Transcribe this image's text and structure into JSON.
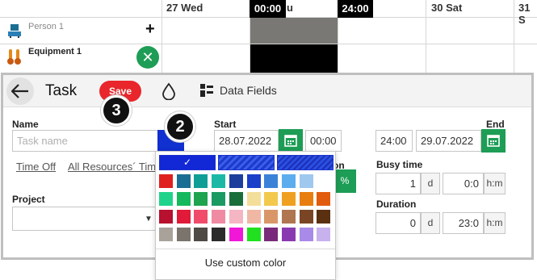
{
  "scheduler": {
    "day_labels": [
      "27 Wed",
      "u",
      "30 Sat",
      "31 S"
    ],
    "start_marker": "00:00",
    "end_marker": "24:00",
    "resources": [
      {
        "label": "Person 1",
        "icon": "person-icon"
      },
      {
        "label": "Equipment 1",
        "icon": "equipment-icon"
      }
    ],
    "add_symbol": "+",
    "remove_symbol": "✕"
  },
  "toolbar": {
    "title": "Task",
    "save_label": "Save",
    "data_fields_label": "Data Fields"
  },
  "form": {
    "name_label": "Name",
    "name_placeholder": "Task name",
    "links": [
      "Time Off",
      "All Resources´ Tim"
    ],
    "project_label": "Project",
    "project_value": "",
    "start_label": "Start",
    "start_date": "28.07.2022",
    "start_time": "00:00",
    "end_label": "End",
    "end_time": "24:00",
    "end_date": "29.07.2022",
    "partial_label": "on",
    "percent_symbol": "%",
    "busy_label": "Busy time",
    "busy_days": "1",
    "busy_days_unit": "d",
    "busy_hm": "0:0",
    "busy_hm_unit": "h:m",
    "duration_label": "Duration",
    "duration_days": "0",
    "duration_days_unit": "d",
    "duration_hm": "23:0",
    "duration_hm_unit": "h:m"
  },
  "color_picker": {
    "selected_check": "✓",
    "custom_label": "Use custom color",
    "swatches": [
      [
        "#e02020",
        "#1b6e93",
        "#0f9e96",
        "#1bb9a5",
        "#1e3e9c",
        "#1a3fc8",
        "#3a82d8",
        "#5cadee",
        "#9fc8ef"
      ],
      [
        "#1fd48a",
        "#15b85c",
        "#1ea34f",
        "#1b9a63",
        "#1a6e3a",
        "#f3de9a",
        "#f2c94c",
        "#f0a020",
        "#e87e10",
        "#e25c0e"
      ],
      [
        "#b8102f",
        "#e01a38",
        "#f04b6a",
        "#f08aa2",
        "#f5b6c4",
        "#f0b8a4",
        "#d99768",
        "#b07650",
        "#7a4525",
        "#5a3010"
      ],
      [
        "#a8a29a",
        "#7a746c",
        "#4f4a44",
        "#2b2b2b",
        "#f017d8",
        "#20e020",
        "#7a2a7a",
        "#8a3ab0",
        "#a88ae8",
        "#c8b2ee"
      ]
    ]
  },
  "badges": [
    "2",
    "3"
  ],
  "accent_colors": {
    "green": "#1d9d55",
    "save_red": "#e8262b",
    "selected_blue": "#1227d6"
  }
}
